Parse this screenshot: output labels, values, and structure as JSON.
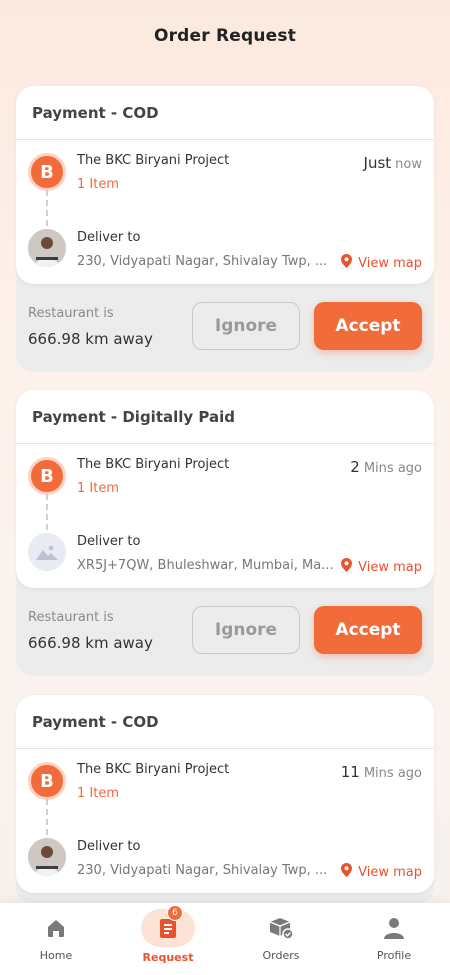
{
  "header": {
    "title": "Order Request"
  },
  "orders": [
    {
      "payment": "Payment - COD",
      "restaurant": "The BKC Biryani Project",
      "items": "1 Item",
      "time_value": "Just",
      "time_unit": "now",
      "deliver_label": "Deliver to",
      "address": "230, Vidyapati Nagar, Shivalay Twp, ...",
      "view_map": "View map",
      "distance_label": "Restaurant is",
      "distance": "666.98 km away",
      "ignore": "Ignore",
      "accept": "Accept",
      "brand_letter": "B",
      "customer_avatar": "person-photo"
    },
    {
      "payment": "Payment - Digitally Paid",
      "restaurant": "The BKC Biryani Project",
      "items": "1 Item",
      "time_value": "2",
      "time_unit": "Mins ago",
      "deliver_label": "Deliver to",
      "address": "XR5J+7QW, Bhuleshwar, Mumbai, Ma...",
      "view_map": "View map",
      "distance_label": "Restaurant is",
      "distance": "666.98 km away",
      "ignore": "Ignore",
      "accept": "Accept",
      "brand_letter": "B",
      "customer_avatar": "image-placeholder"
    },
    {
      "payment": "Payment - COD",
      "restaurant": "The BKC Biryani Project",
      "items": "1 Item",
      "time_value": "11",
      "time_unit": "Mins ago",
      "deliver_label": "Deliver to",
      "address": "230, Vidyapati Nagar, Shivalay Twp, ...",
      "view_map": "View map",
      "brand_letter": "B",
      "customer_avatar": "person-photo"
    }
  ],
  "nav": {
    "items": [
      {
        "label": "Home",
        "icon": "home-icon"
      },
      {
        "label": "Request",
        "icon": "request-icon",
        "badge": "6",
        "active": true
      },
      {
        "label": "Orders",
        "icon": "orders-icon"
      },
      {
        "label": "Profile",
        "icon": "profile-icon"
      }
    ]
  },
  "colors": {
    "accent": "#f26b3a",
    "background": "#fdf1ea"
  }
}
